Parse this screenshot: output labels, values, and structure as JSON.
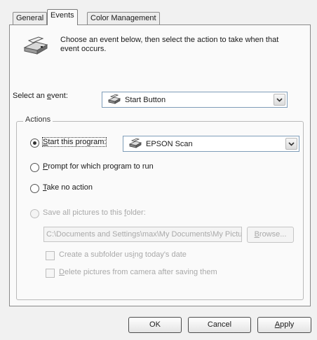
{
  "tabs": [
    {
      "label": "General"
    },
    {
      "label": "Events"
    },
    {
      "label": "Color Management"
    }
  ],
  "header": {
    "description_line1": "Choose an event below, then select the action to take when that",
    "description_line2": "event occurs."
  },
  "event": {
    "label_prefix": "Select an ",
    "label_accel": "e",
    "label_suffix": "vent:",
    "selected": "Start Button"
  },
  "actions": {
    "legend": "Actions",
    "start_program": {
      "accel": "S",
      "rest": "tart this program:",
      "checked": true,
      "program": "EPSON Scan"
    },
    "prompt": {
      "accel": "P",
      "rest": "rompt for which program to run",
      "checked": false
    },
    "no_action": {
      "accel": "T",
      "rest": "ake no action",
      "checked": false
    },
    "save_pictures": {
      "prefix": "Save all pictures to this ",
      "accel": "f",
      "suffix": "older:",
      "enabled": false
    },
    "folder_path": "C:\\Documents and Settings\\max\\My Documents\\My Pictures",
    "browse": {
      "accel": "B",
      "rest": "rowse..."
    },
    "subfolder": {
      "prefix": "Create a subfolder us",
      "accel": "i",
      "suffix": "ng today's date",
      "checked": false
    },
    "delete_after": {
      "prefix": "",
      "accel": "D",
      "suffix": "elete pictures from camera after saving them",
      "checked": false
    }
  },
  "footer": {
    "ok": "OK",
    "cancel": "Cancel",
    "apply_accel": "A",
    "apply_rest": "pply"
  }
}
